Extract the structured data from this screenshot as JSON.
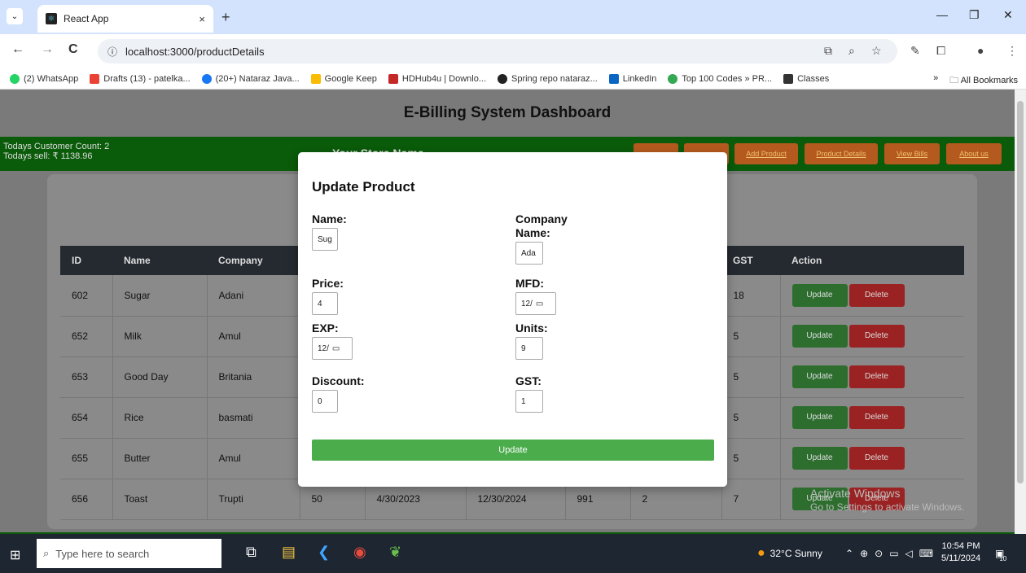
{
  "browser": {
    "tab_title": "React App",
    "new_tab": "+",
    "tab_close": "×",
    "tab_list": "⌄",
    "window_controls": {
      "minimize": "—",
      "restore": "❐",
      "close": "✕"
    },
    "nav": {
      "back": "←",
      "forward": "→",
      "reload": "C"
    },
    "url": "localhost:3000/productDetails",
    "url_info_icon": "ⓘ",
    "bookmarks": [
      {
        "label": "(2) WhatsApp",
        "color": "#25d366"
      },
      {
        "label": "Drafts (13) - patelka...",
        "color": "#ea4335"
      },
      {
        "label": "(20+) Nataraz Java...",
        "color": "#1877f2"
      },
      {
        "label": "Google Keep",
        "color": "#fbbc04"
      },
      {
        "label": "HDHub4u | Downlo...",
        "color": "#c62828"
      },
      {
        "label": "Spring repo nataraz...",
        "color": "#222222"
      },
      {
        "label": "LinkedIn",
        "color": "#0a66c2"
      },
      {
        "label": "Top 100 Codes » PR...",
        "color": "#34a853"
      },
      {
        "label": "Classes",
        "color": "#333333"
      }
    ],
    "bookmarks_more": "»",
    "all_bookmarks": "All Bookmarks"
  },
  "app": {
    "title": "E-Billing System Dashboard",
    "customer_count": "Todays Customer Count: 2",
    "todays_sell": "Todays sell: ₹ 1138.96",
    "store_name": "Your Store Name",
    "nav": [
      "Add Product",
      "Product Details",
      "View Bills",
      "About us"
    ],
    "table": {
      "headers": [
        "ID",
        "Name",
        "Company",
        "",
        "",
        "",
        "",
        "",
        "GST",
        "Action"
      ],
      "rows": [
        [
          "602",
          "Sugar",
          "Adani",
          "",
          "",
          "",
          "",
          "",
          "18"
        ],
        [
          "652",
          "Milk",
          "Amul",
          "",
          "",
          "",
          "",
          "",
          "5"
        ],
        [
          "653",
          "Good Day",
          "Britania",
          "",
          "",
          "",
          "",
          "",
          "5"
        ],
        [
          "654",
          "Rice",
          "basmati",
          "",
          "",
          "",
          "",
          "",
          "5"
        ],
        [
          "655",
          "Butter",
          "Amul",
          "",
          "",
          "",
          "",
          "",
          "5"
        ],
        [
          "656",
          "Toast",
          "Trupti",
          "50",
          "4/30/2023",
          "12/30/2024",
          "991",
          "2",
          "7"
        ]
      ],
      "update_label": "Update",
      "delete_label": "Delete"
    }
  },
  "modal": {
    "title": "Update Product",
    "fields": {
      "name": {
        "label": "Name:",
        "value": "Sug"
      },
      "company": {
        "label": "Company Name:",
        "value": "Ada"
      },
      "price": {
        "label": "Price:",
        "value": "4"
      },
      "mfd": {
        "label": "MFD:",
        "value": "12/"
      },
      "exp": {
        "label": "EXP:",
        "value": "12/"
      },
      "units": {
        "label": "Units:",
        "value": "9"
      },
      "discount": {
        "label": "Discount:",
        "value": "0"
      },
      "gst": {
        "label": "GST:",
        "value": "1"
      }
    },
    "submit": "Update"
  },
  "watermark": {
    "line1": "Activate Windows",
    "line2": "Go to Settings to activate Windows."
  },
  "taskbar": {
    "search_placeholder": "Type here to search",
    "weather": "32°C Sunny",
    "time": "10:54 PM",
    "date": "5/11/2024",
    "notification_count": "10"
  }
}
